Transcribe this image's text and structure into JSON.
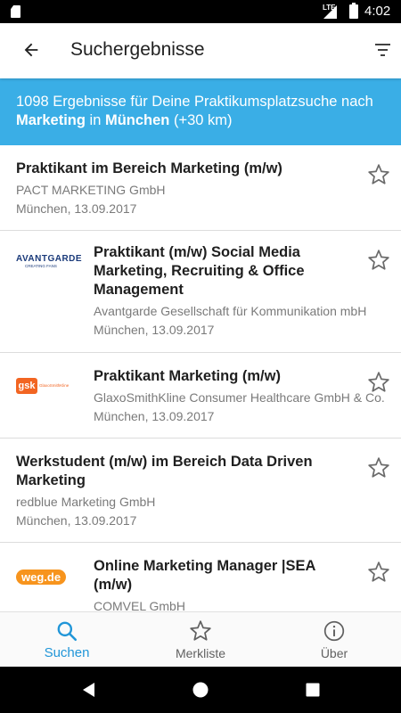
{
  "status_bar": {
    "network": "LTE",
    "time": "4:02"
  },
  "app_bar": {
    "title": "Suchergebnisse",
    "back_icon": "arrow-left-icon",
    "filter_icon": "filter-icon"
  },
  "banner": {
    "count": "1098",
    "text1": " Ergebnisse für Deine Praktikumsplatzsuche nach ",
    "keyword": "Marketing",
    "text2": " in ",
    "city": "München",
    "text3": " (+30 km)",
    "bg_color": "#3aaee6"
  },
  "results": [
    {
      "title": "Praktikant im Bereich Marketing (m/w)",
      "company": "PACT MARKETING GmbH",
      "meta": "München, 13.09.2017",
      "logo": ""
    },
    {
      "title": "Praktikant (m/w) Social Media Marketing, Recruiting & Office Management",
      "company": "Avantgarde Gesellschaft für Kommunikation mbH",
      "meta": "München, 13.09.2017",
      "logo": "avantgarde",
      "logo_text": "AVANTGARDE",
      "logo_sub": "CREATING FANS"
    },
    {
      "title": "Praktikant Marketing (m/w)",
      "company": "GlaxoSmithKline Consumer Healthcare GmbH & Co. KG",
      "meta": "München, 13.09.2017",
      "logo": "gsk",
      "logo_text": "gsk",
      "logo_sub": "GlaxoSmithKline"
    },
    {
      "title": "Werkstudent (m/w) im Bereich Data Driven Marketing",
      "company": "redblue Marketing GmbH",
      "meta": "München, 13.09.2017",
      "logo": ""
    },
    {
      "title": "Online Marketing Manager |SEA (m/w)",
      "company": "COMVEL GmbH",
      "meta": "",
      "logo": "weg",
      "logo_text": "weg.de"
    }
  ],
  "bottom_nav": [
    {
      "label": "Suchen",
      "icon": "search-icon",
      "active": true
    },
    {
      "label": "Merkliste",
      "icon": "star-outline-icon",
      "active": false
    },
    {
      "label": "Über",
      "icon": "info-icon",
      "active": false
    }
  ],
  "colors": {
    "accent": "#2196d8",
    "banner": "#3aaee6"
  }
}
